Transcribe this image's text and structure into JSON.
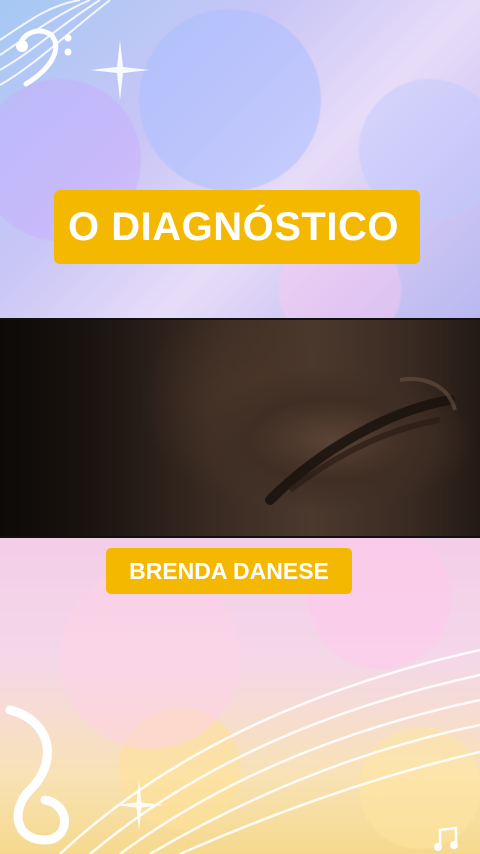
{
  "title": "O DIAGNÓSTICO",
  "name": "BRENDA DANESE",
  "icons": {
    "top_left": "bass-clef-icon",
    "bottom_left": "treble-clef-icon",
    "bottom_right": "music-note-icon"
  },
  "colors": {
    "label_background": "#f5b800",
    "label_text": "#ffffff"
  }
}
